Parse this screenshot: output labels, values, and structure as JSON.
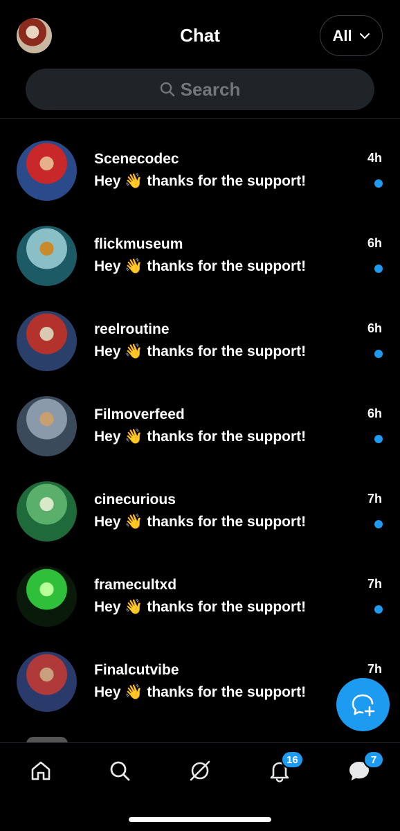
{
  "header": {
    "title": "Chat",
    "filter_label": "All",
    "search_placeholder": "Search"
  },
  "conversations": [
    {
      "name": "Scenecodec",
      "message": "Hey 👋 thanks for the support!",
      "time": "4h",
      "unread": true,
      "avatar_colors": [
        "#2a4a8a",
        "#c8282a",
        "#e6b08a"
      ]
    },
    {
      "name": "flickmuseum",
      "message": "Hey 👋 thanks for the support!",
      "time": "6h",
      "unread": true,
      "avatar_colors": [
        "#1c5a66",
        "#8bbfc8",
        "#c88a2a"
      ]
    },
    {
      "name": "reelroutine",
      "message": "Hey 👋 thanks for the support!",
      "time": "6h",
      "unread": true,
      "avatar_colors": [
        "#2a3f6a",
        "#b3322c",
        "#d9c9b0"
      ]
    },
    {
      "name": "Filmoverfeed",
      "message": "Hey 👋 thanks for the support!",
      "time": "6h",
      "unread": true,
      "avatar_colors": [
        "#3a4a5a",
        "#8a9aaa",
        "#c8a070"
      ]
    },
    {
      "name": "cinecurious",
      "message": "Hey 👋 thanks for the support!",
      "time": "7h",
      "unread": true,
      "avatar_colors": [
        "#1f6a3a",
        "#5ab06a",
        "#d8e8c8"
      ]
    },
    {
      "name": "framecultxd",
      "message": "Hey 👋 thanks for the support!",
      "time": "7h",
      "unread": true,
      "avatar_colors": [
        "#0a1a0a",
        "#2fbf3a",
        "#b8ff9a"
      ]
    },
    {
      "name": "Finalcutvibe",
      "message": "Hey 👋 thanks for the support!",
      "time": "7h",
      "unread": false,
      "avatar_colors": [
        "#2a3a6a",
        "#b03a3a",
        "#c8a080"
      ]
    }
  ],
  "tabbar": {
    "notifications_badge": "16",
    "messages_badge": "7"
  },
  "icons": {
    "home": "home-icon",
    "search": "search-icon",
    "grok": "grok-icon",
    "notifications": "bell-icon",
    "messages": "chat-bubble-icon",
    "new_chat": "new-chat-icon"
  },
  "colors": {
    "accent": "#1d9bf0",
    "background": "#000000",
    "search_bg": "#202327",
    "muted_text": "#71767b"
  }
}
